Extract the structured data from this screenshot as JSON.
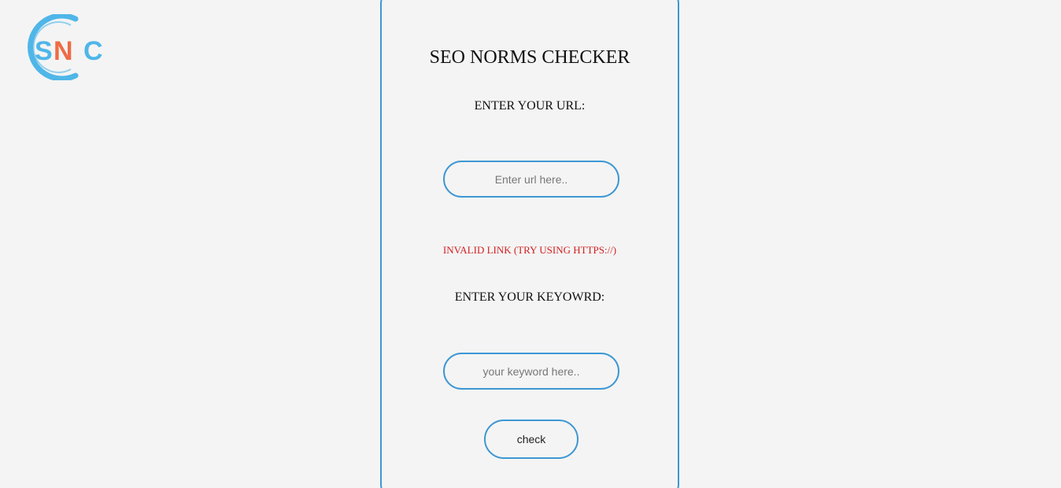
{
  "logo": {
    "text": "SNC",
    "colors": {
      "ring": "#4fb6e8",
      "s": "#4fb6e8",
      "n": "#ee6b45",
      "c": "#4fb6e8"
    }
  },
  "form": {
    "title": "SEO NORMS CHECKER",
    "url_label": "ENTER YOUR URL:",
    "url_placeholder": "Enter url here..",
    "url_value": "",
    "error_text": "INVALID LINK (TRY USING HTTPS://)",
    "keyword_label": "ENTER YOUR KEYOWRD:",
    "keyword_placeholder": "your keyword here..",
    "keyword_value": "",
    "check_button": "check"
  },
  "colors": {
    "accent": "#3d97d3",
    "error": "#d21f1f",
    "background": "#f4f4f4"
  }
}
